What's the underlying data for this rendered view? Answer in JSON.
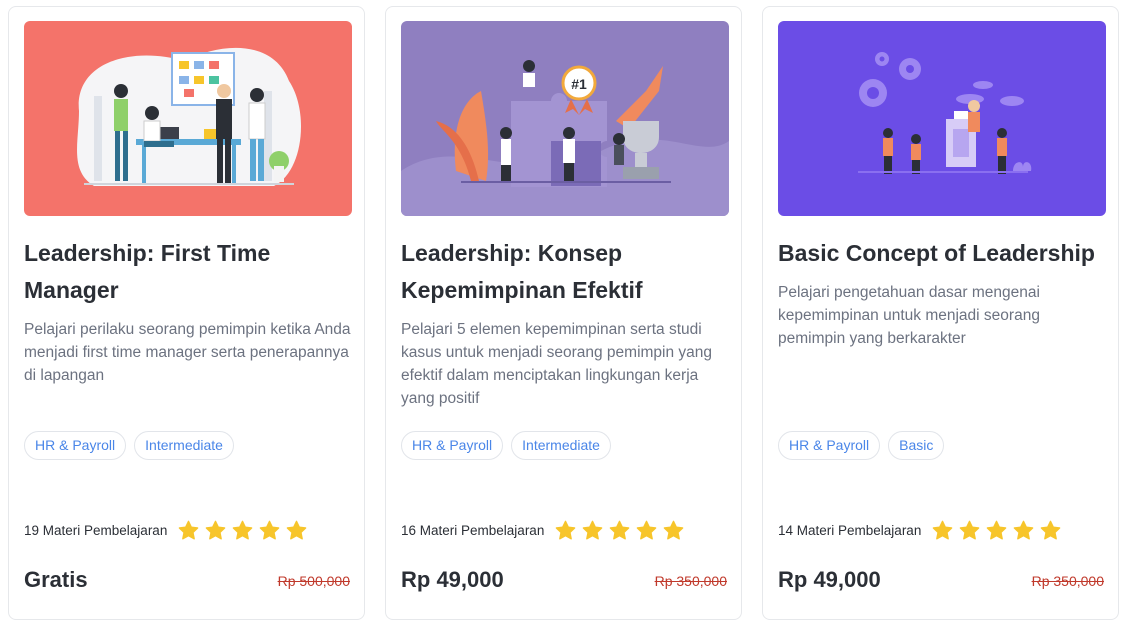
{
  "courses": [
    {
      "title": "Leadership: First Time Manager",
      "description": "Pelajari perilaku seorang pemimpin ketika Anda menjadi first time manager serta penerapannya di lapangan",
      "tags": [
        "HR & Payroll",
        "Intermediate"
      ],
      "materi": "19 Materi Pembelajaran",
      "rating": 5,
      "price": "Gratis",
      "old_price": "Rp 500,000",
      "thumb_color": "#f4736a"
    },
    {
      "title": "Leadership: Konsep Kepemimpinan Efektif",
      "description": "Pelajari 5 elemen kepemimpinan serta studi kasus untuk menjadi seorang pemimpin yang efektif dalam menciptakan lingkungan kerja yang positif",
      "tags": [
        "HR & Payroll",
        "Intermediate"
      ],
      "materi": "16 Materi Pembelajaran",
      "rating": 5,
      "price": "Rp 49,000",
      "old_price": "Rp 350,000",
      "thumb_color": "#8f7fc0",
      "badge_text": "#1"
    },
    {
      "title": "Basic Concept of Leadership",
      "description": "Pelajari pengetahuan dasar mengenai kepemimpinan untuk menjadi seorang pemimpin yang berkarakter",
      "tags": [
        "HR & Payroll",
        "Basic"
      ],
      "materi": "14 Materi Pembelajaran",
      "rating": 5,
      "price": "Rp 49,000",
      "old_price": "Rp 350,000",
      "thumb_color": "#6b4de6"
    }
  ],
  "colors": {
    "star": "#f7c52b",
    "tag_text": "#4a86e8",
    "old_price": "#c0392b"
  }
}
